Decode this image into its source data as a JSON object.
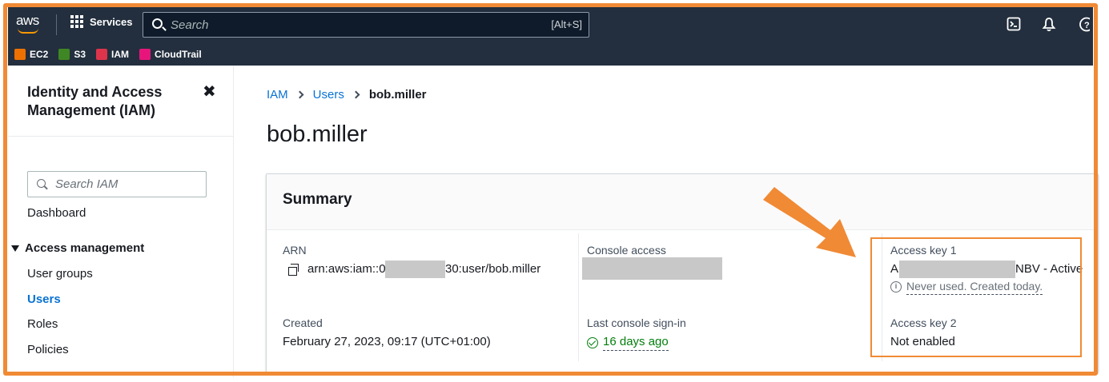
{
  "topbar": {
    "logo": "aws",
    "services_label": "Services",
    "search_placeholder": "Search",
    "search_shortcut": "[Alt+S]",
    "icons": [
      "cloudshell-icon",
      "bell-icon",
      "help-icon"
    ]
  },
  "favorites": [
    {
      "label": "EC2",
      "color": "#ed7100"
    },
    {
      "label": "S3",
      "color": "#3f8624"
    },
    {
      "label": "IAM",
      "color": "#dd344c"
    },
    {
      "label": "CloudTrail",
      "color": "#e7157b"
    }
  ],
  "sidebar": {
    "title_line1": "Identity and Access",
    "title_line2": "Management (IAM)",
    "search_placeholder": "Search IAM",
    "dashboard": "Dashboard",
    "section": "Access management",
    "items": [
      "User groups",
      "Users",
      "Roles",
      "Policies"
    ],
    "active_item": "Users"
  },
  "breadcrumb": [
    "IAM",
    "Users",
    "bob.miller"
  ],
  "page_title": "bob.miller",
  "summary": {
    "heading": "Summary",
    "arn_label": "ARN",
    "arn_prefix": "arn:aws:iam::0",
    "arn_suffix": "30:user/bob.miller",
    "console_access_label": "Console access",
    "access_key1_label": "Access key 1",
    "access_key1_prefix": "A",
    "access_key1_suffix": "NBV - Active",
    "access_key1_note": "Never used. Created today.",
    "created_label": "Created",
    "created_value": "February 27, 2023, 09:17 (UTC+01:00)",
    "last_signin_label": "Last console sign-in",
    "last_signin_value": "16 days ago",
    "access_key2_label": "Access key 2",
    "access_key2_value": "Not enabled"
  },
  "annotation_color": "#f08a35"
}
